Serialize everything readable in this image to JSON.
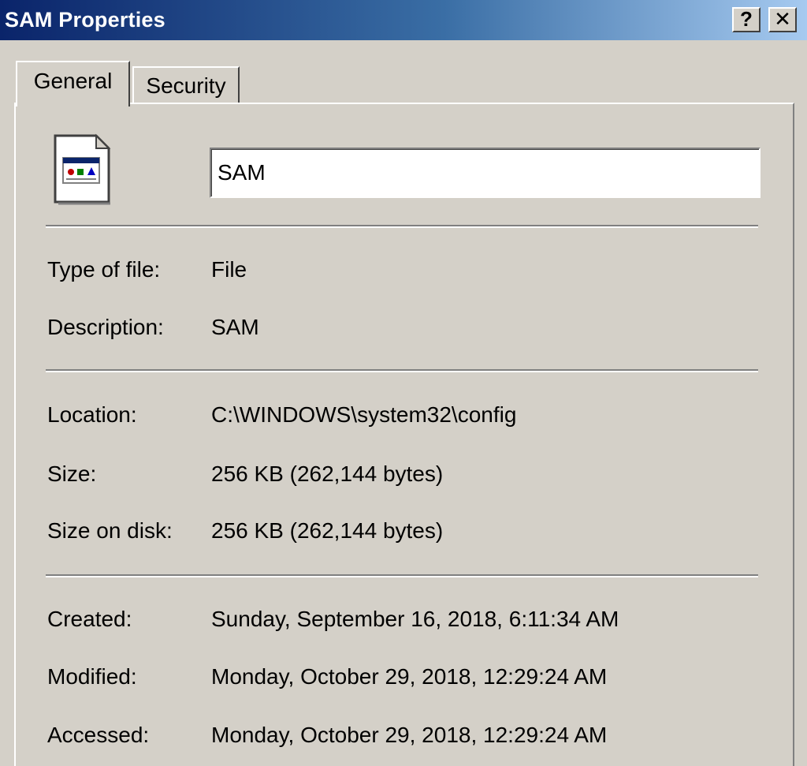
{
  "window": {
    "title": "SAM Properties",
    "help_label": "?",
    "close_label": "✕"
  },
  "tabs": [
    {
      "label": "General",
      "active": true
    },
    {
      "label": "Security",
      "active": false
    }
  ],
  "general": {
    "icon": "file-icon",
    "name_value": "SAM",
    "fields": [
      {
        "label": "Type of file:",
        "value": "File"
      },
      {
        "label": "Description:",
        "value": "SAM"
      },
      {
        "label": "Location:",
        "value": "C:\\WINDOWS\\system32\\config"
      },
      {
        "label": "Size:",
        "value": "256 KB (262,144 bytes)"
      },
      {
        "label": "Size on disk:",
        "value": "256 KB (262,144 bytes)"
      },
      {
        "label": "Created:",
        "value": "Sunday, September 16, 2018, 6:11:34 AM"
      },
      {
        "label": "Modified:",
        "value": "Monday, October 29, 2018, 12:29:24 AM"
      },
      {
        "label": "Accessed:",
        "value": "Monday, October 29, 2018, 12:29:24 AM"
      }
    ]
  },
  "colors": {
    "titlebar_start": "#0a246a",
    "titlebar_end": "#a6caf0",
    "face": "#d4d0c8"
  }
}
